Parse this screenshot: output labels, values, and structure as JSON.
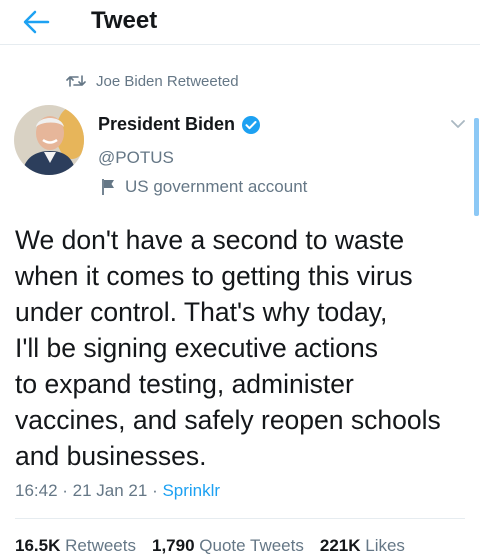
{
  "header": {
    "title": "Tweet"
  },
  "retweet": {
    "text": "Joe Biden Retweeted"
  },
  "author": {
    "name": "President Biden",
    "handle": "@POTUS",
    "label": "US government account"
  },
  "tweet": {
    "lines": [
      "We don't have a second to waste",
      "when it comes to getting this virus",
      "under control. That's why today,",
      "I'll be signing executive actions",
      "to expand testing, administer",
      "vaccines, and safely reopen schools",
      "and businesses."
    ],
    "time": "16:42",
    "date": "21 Jan 21",
    "source": "Sprinklr"
  },
  "stats": {
    "retweets_count": "16.5K",
    "retweets_label": "Retweets",
    "quotes_count": "1,790",
    "quotes_label": "Quote Tweets",
    "likes_count": "221K",
    "likes_label": "Likes"
  },
  "colors": {
    "accent": "#1da1f2",
    "muted": "#657786",
    "text": "#14171a"
  },
  "icons": [
    "back-arrow-icon",
    "retweet-icon",
    "verified-badge-icon",
    "flag-icon",
    "chevron-down-icon"
  ]
}
